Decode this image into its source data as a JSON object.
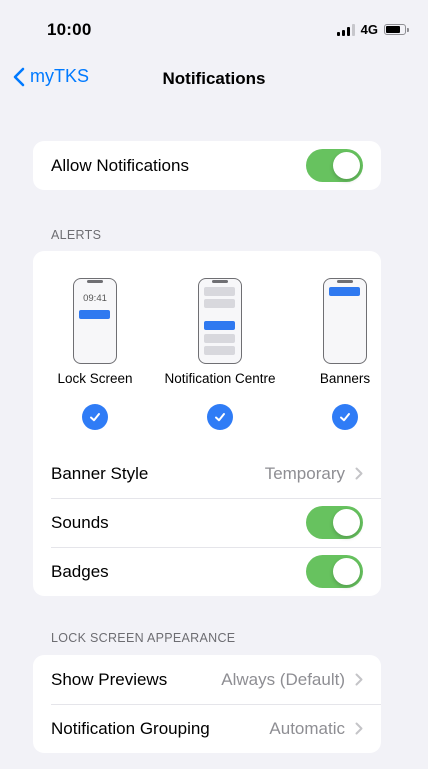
{
  "status_bar": {
    "time": "10:00",
    "network": "4G"
  },
  "nav": {
    "back_label": "myTKS",
    "title": "Notifications"
  },
  "allow_notifications": {
    "label": "Allow Notifications",
    "enabled": true
  },
  "alerts": {
    "header": "ALERTS",
    "options": [
      {
        "label": "Lock Screen",
        "preview_time": "09:41",
        "checked": true
      },
      {
        "label": "Notification Centre",
        "checked": true
      },
      {
        "label": "Banners",
        "checked": true
      }
    ],
    "banner_style": {
      "label": "Banner Style",
      "value": "Temporary"
    },
    "sounds": {
      "label": "Sounds",
      "enabled": true
    },
    "badges": {
      "label": "Badges",
      "enabled": true
    }
  },
  "lock_screen_appearance": {
    "header": "LOCK SCREEN APPEARANCE",
    "show_previews": {
      "label": "Show Previews",
      "value": "Always (Default)"
    },
    "notification_grouping": {
      "label": "Notification Grouping",
      "value": "Automatic"
    }
  },
  "colors": {
    "accent": "#007aff",
    "toggle_on": "#67c25f",
    "check": "#2f7cf6",
    "background": "#f2f2f7"
  }
}
